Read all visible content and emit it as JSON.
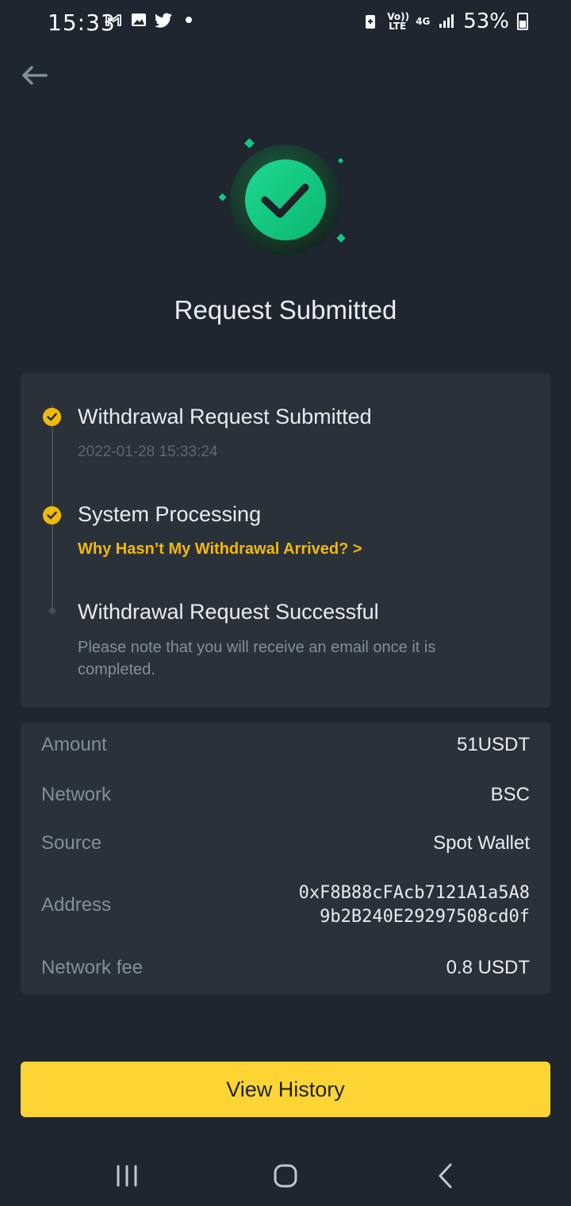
{
  "status_bar": {
    "time": "15:33",
    "left_icons": [
      "gmail-icon",
      "gallery-icon",
      "twitter-icon",
      "notification-dot-icon"
    ],
    "network_volte": "Vo)) LTE",
    "network_type": "4G",
    "battery_percent": "53%"
  },
  "header": {
    "back_icon": "arrow-left-icon"
  },
  "hero": {
    "icon": "success-check-icon",
    "accent_color": "#0ecb81",
    "title": "Request Submitted"
  },
  "timeline": {
    "steps": [
      {
        "title": "Withdrawal Request Submitted",
        "timestamp": "2022-01-28 15:33:24",
        "status": "done"
      },
      {
        "title": "System Processing",
        "link": "Why Hasn’t My Withdrawal Arrived? >",
        "status": "done"
      },
      {
        "title": "Withdrawal Request Successful",
        "note": "Please note that you will receive an email once it is completed.",
        "status": "pending"
      }
    ],
    "done_color": "#f0b90b"
  },
  "details": {
    "rows": [
      {
        "label": "Amount",
        "value": "51USDT"
      },
      {
        "label": "Network",
        "value": "BSC"
      },
      {
        "label": "Source",
        "value": "Spot Wallet"
      },
      {
        "label": "Address",
        "value_line1": "0xF8B88cFAcb7121A1a5A8",
        "value_line2": "9b2B240E29297508cd0f"
      },
      {
        "label": "Network fee",
        "value": "0.8 USDT"
      }
    ]
  },
  "actions": {
    "view_history_label": "View History",
    "button_color": "#fcd535"
  },
  "nav_bar": {
    "recents_icon": "recents-icon",
    "home_icon": "home-icon",
    "back_icon": "back-chevron-icon"
  }
}
